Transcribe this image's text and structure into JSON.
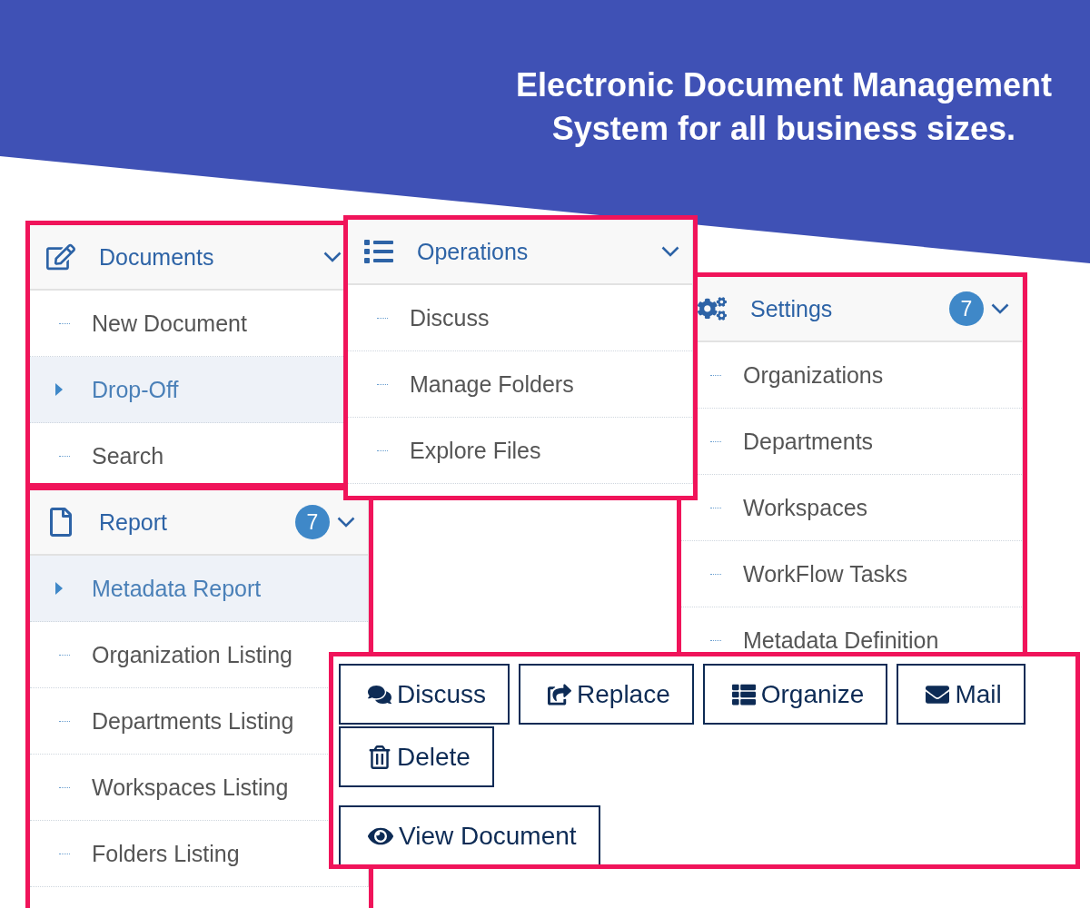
{
  "headline": [
    "Electronic Document Management",
    "System for all business sizes."
  ],
  "panels": [
    {
      "title": "Documents",
      "items": [
        {
          "label": "New Document",
          "selected": false
        },
        {
          "label": "Drop-Off",
          "selected": true
        },
        {
          "label": "Search",
          "selected": false
        }
      ]
    },
    {
      "title": "Settings",
      "badge": "7",
      "items": [
        {
          "label": "Organizations",
          "selected": false
        },
        {
          "label": "Departments",
          "selected": false
        },
        {
          "label": "Workspaces",
          "selected": false
        },
        {
          "label": "WorkFlow Tasks",
          "selected": false
        },
        {
          "label": "Metadata Definition",
          "selected": false
        }
      ]
    },
    {
      "title": "Operations",
      "items": [
        {
          "label": "Discuss",
          "selected": false
        },
        {
          "label": "Manage Folders",
          "selected": false
        },
        {
          "label": "Explore Files",
          "selected": false
        }
      ]
    },
    {
      "title": "Report",
      "badge": "7",
      "items": [
        {
          "label": "Metadata Report",
          "selected": true
        },
        {
          "label": "Organization Listing",
          "selected": false
        },
        {
          "label": "Departments Listing",
          "selected": false
        },
        {
          "label": "Workspaces Listing",
          "selected": false
        },
        {
          "label": "Folders Listing",
          "selected": false
        }
      ]
    }
  ],
  "actions": [
    "Discuss",
    "Replace",
    "Organize",
    "Mail",
    "Delete"
  ],
  "view_action": "View Document"
}
